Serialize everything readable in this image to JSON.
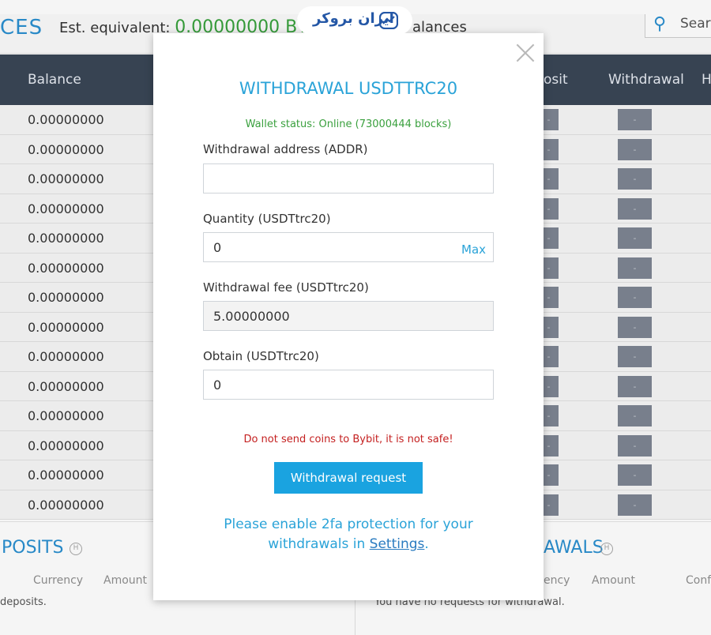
{
  "header": {
    "title_fragment": "CES",
    "est_label": "Est. equivalent:",
    "est_value": "0.00000000 BTC",
    "balances_fragment": "alances",
    "search_placeholder": "Sear"
  },
  "table": {
    "columns": [
      "Balance",
      "osit",
      "Withdrawal",
      "H"
    ],
    "balances": [
      "0.00000000",
      "0.00000000",
      "0.00000000",
      "0.00000000",
      "0.00000000",
      "0.00000000",
      "0.00000000",
      "0.00000000",
      "0.00000000",
      "0.00000000",
      "0.00000000",
      "0.00000000",
      "0.00000000",
      "0.00000000"
    ],
    "deposit_button": "-",
    "withdraw_button": "-"
  },
  "lower": {
    "deposits_title": "POSITS",
    "deposits_icon_letter": "H",
    "deposits_columns": [
      "Currency",
      "Amount"
    ],
    "deposits_note": "deposits.",
    "withdrawals_title": "AWALS",
    "withdrawals_icon_letter": "H",
    "withdrawals_columns": [
      "ency",
      "Amount",
      "Conf"
    ],
    "withdrawals_note": "You have no requests for withdrawal."
  },
  "watermark": {
    "text": "ایران بروکر",
    "icon": "trend-logo-icon"
  },
  "modal": {
    "title": "WITHDRAWAL USDTTRC20",
    "wallet_status": "Wallet status: Online (73000444 blocks)",
    "address_label": "Withdrawal address (ADDR)",
    "address_value": "",
    "quantity_label": "Quantity (USDTtrc20)",
    "quantity_value": "0",
    "max_label": "Max",
    "fee_label": "Withdrawal fee (USDTtrc20)",
    "fee_value": "5.00000000",
    "obtain_label": "Obtain (USDTtrc20)",
    "obtain_value": "0",
    "warning": "Do not send coins to Bybit, it is not safe!",
    "request_button": "Withdrawal request",
    "twofa_line1": "Please enable 2fa protection for your",
    "twofa_line2_prefix": "withdrawals in ",
    "twofa_link": "Settings",
    "twofa_suffix": "."
  },
  "colors": {
    "accent": "#2aa3d8",
    "status_green": "#3aa03e",
    "warning_red": "#c42020",
    "table_header": "#3a4656",
    "button": "#1aa3e0"
  }
}
